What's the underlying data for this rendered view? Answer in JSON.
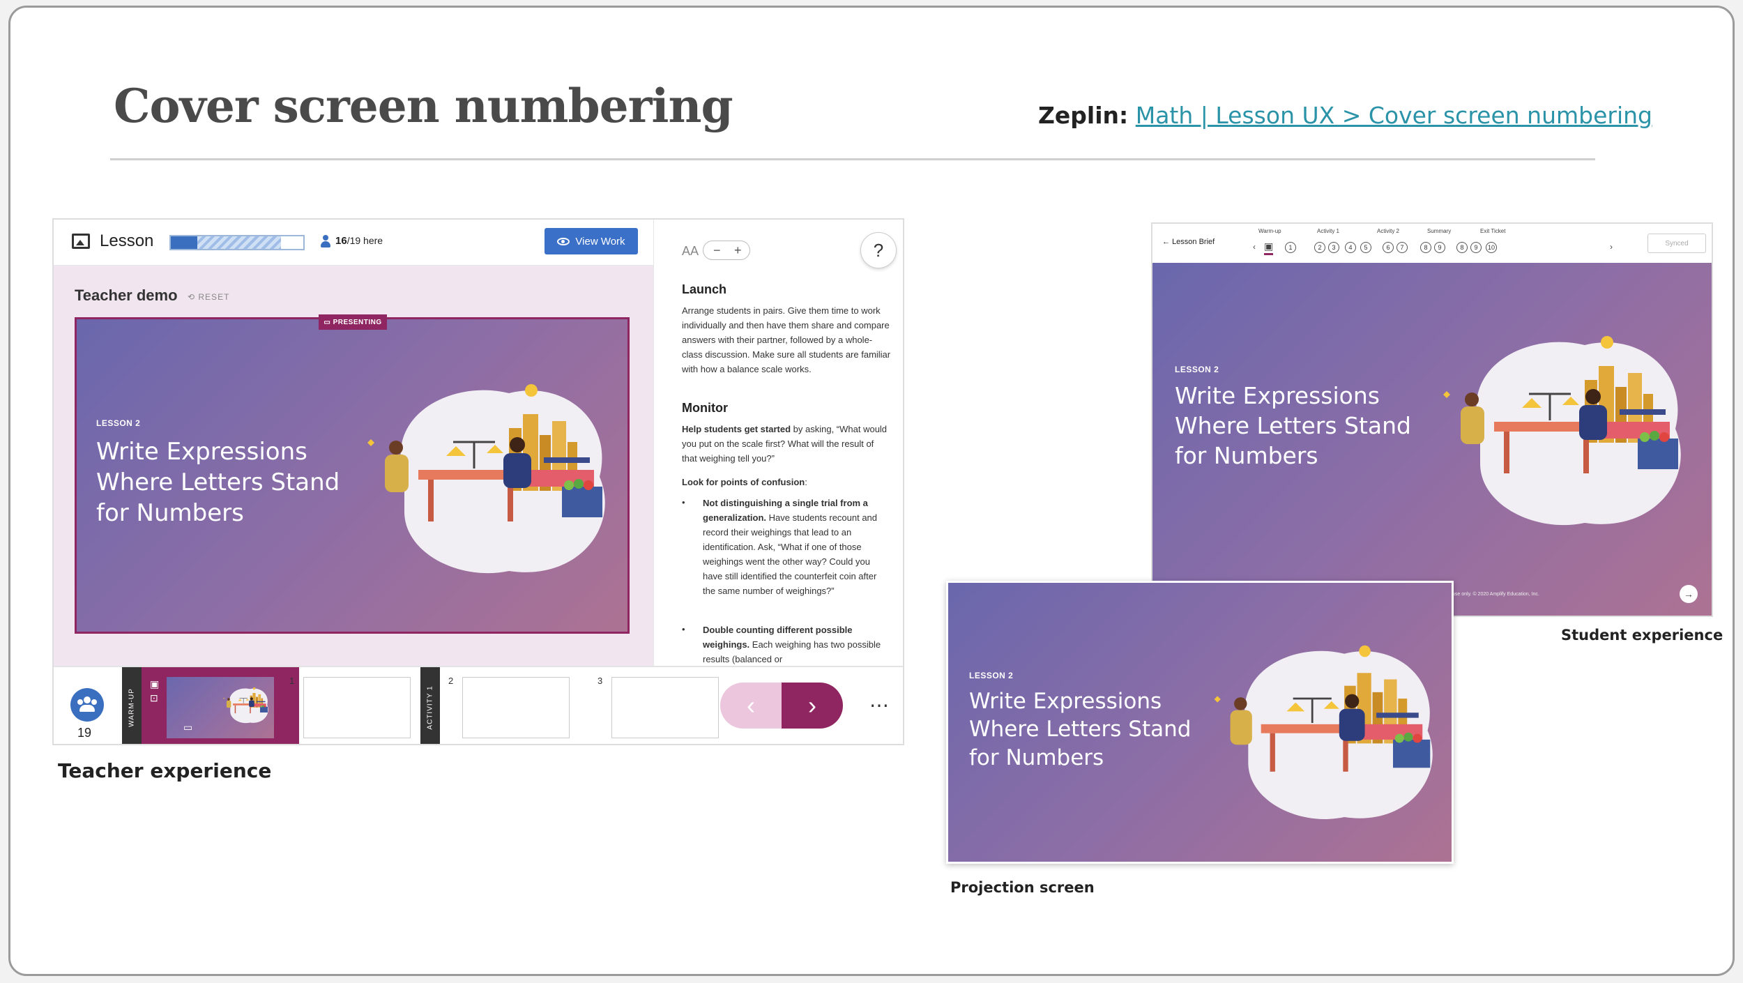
{
  "page": {
    "title": "Cover screen numbering"
  },
  "zeplin": {
    "label": "Zeplin:",
    "link": "Math | Lesson UX  >  Cover screen numbering"
  },
  "teacher": {
    "caption": "Teacher experience",
    "topbar": {
      "lesson_label": "Lesson",
      "progress": 0.2,
      "progress_seen": 0.83,
      "present": "16",
      "total": "/19 here",
      "view_work": "View Work"
    },
    "demo_label": "Teacher demo",
    "reset_label": "RESET",
    "presenting_badge": "PRESENTING",
    "slide": {
      "kicker": "LESSON 2",
      "line1": "Write Expressions",
      "line2": "Where Letters Stand",
      "line3": "for Numbers"
    },
    "panel": {
      "text_size_label": "AA",
      "minus": "−",
      "plus": "+",
      "help": "?",
      "launch_heading": "Launch",
      "launch_text": "Arrange students in pairs. Give them time to work individually and then have them share and compare answers with their partner, followed by a whole-class discussion. Make sure all students are familiar with how a balance scale works.",
      "monitor_heading": "Monitor",
      "help_lead": "Help students get started",
      "help_text": " by asking, “What would you put on the scale first? What will the result of that weighing tell you?”",
      "confusion": "Look for points of confusion",
      "confusion_colon": ":",
      "b1_lead": "Not distinguishing a single trial from a generalization.",
      "b1_text": " Have students recount and record their weighings that lead to an identification. Ask, “What if one of those weighings went the other way? Could you have still identified the counterfeit coin after the same number of weighings?”",
      "b2_lead": "Double counting different possible weighings.",
      "b2_text": " Each weighing has two possible results (balanced or"
    },
    "strip": {
      "count": "19",
      "sect1": "WARM-UP",
      "sect2": "ACTIVITY 1",
      "n1": "1",
      "n2": "2",
      "n3": "3",
      "prev": "‹",
      "next": "›",
      "more": "⋯"
    }
  },
  "student": {
    "caption": "Student experience",
    "back": "Lesson Brief",
    "synced": "Synced",
    "sections": [
      "Warm-up",
      "Activity 1",
      "Activity 2",
      "Summary",
      "Exit Ticket"
    ],
    "steps": [
      "1",
      "2",
      "3",
      "4",
      "5",
      "6",
      "7",
      "8",
      "9",
      "8",
      "9",
      "10"
    ],
    "slide": {
      "kicker": "LESSON 2",
      "line1": "Write Expressions",
      "line2": "Where Letters Stand",
      "line3": "for Numbers"
    },
    "copyright": "use only. © 2020 Amplify Education, Inc."
  },
  "projection": {
    "caption": "Projection screen",
    "slide": {
      "kicker": "LESSON 2",
      "line1": "Write Expressions",
      "line2": "Where Letters Stand",
      "line3": "for Numbers"
    }
  },
  "colors": {
    "brand": "#8f2561",
    "primary_blue": "#3a70c8",
    "link": "#2b93a8"
  }
}
